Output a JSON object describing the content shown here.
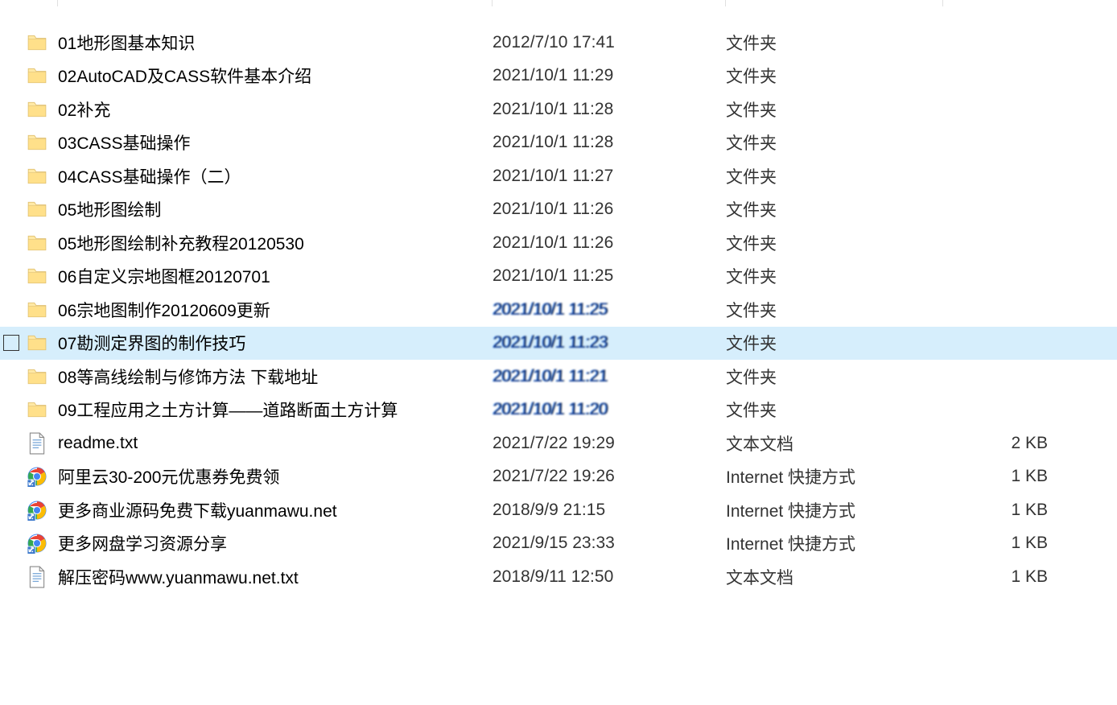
{
  "files": [
    {
      "icon": "folder",
      "name": "01地形图基本知识",
      "date": "2012/7/10 17:41",
      "type": "文件夹",
      "size": ""
    },
    {
      "icon": "folder",
      "name": "02AutoCAD及CASS软件基本介绍",
      "date": "2021/10/1 11:29",
      "type": "文件夹",
      "size": ""
    },
    {
      "icon": "folder",
      "name": "02补充",
      "date": "2021/10/1 11:28",
      "type": "文件夹",
      "size": ""
    },
    {
      "icon": "folder",
      "name": "03CASS基础操作",
      "date": "2021/10/1 11:28",
      "type": "文件夹",
      "size": ""
    },
    {
      "icon": "folder",
      "name": "04CASS基础操作（二）",
      "date": "2021/10/1 11:27",
      "type": "文件夹",
      "size": ""
    },
    {
      "icon": "folder",
      "name": "05地形图绘制",
      "date": "2021/10/1 11:26",
      "type": "文件夹",
      "size": ""
    },
    {
      "icon": "folder",
      "name": "05地形图绘制补充教程20120530",
      "date": "2021/10/1 11:26",
      "type": "文件夹",
      "size": ""
    },
    {
      "icon": "folder",
      "name": "06自定义宗地图框20120701",
      "date": "2021/10/1 11:25",
      "type": "文件夹",
      "size": ""
    },
    {
      "icon": "folder",
      "name": "06宗地图制作20120609更新",
      "date": "2021/10/1 11:25",
      "type": "文件夹",
      "size": "",
      "distorted": true
    },
    {
      "icon": "folder",
      "name": "07勘测定界图的制作技巧",
      "date": "2021/10/1 11:23",
      "type": "文件夹",
      "size": "",
      "hover": true,
      "distorted": true
    },
    {
      "icon": "folder",
      "name": "08等高线绘制与修饰方法 下载地址",
      "date": "2021/10/1 11:21",
      "type": "文件夹",
      "size": "",
      "distorted": true
    },
    {
      "icon": "folder",
      "name": "09工程应用之土方计算——道路断面土方计算",
      "date": "2021/10/1 11:20",
      "type": "文件夹",
      "size": "",
      "distorted": true
    },
    {
      "icon": "txt",
      "name": "readme.txt",
      "date": "2021/7/22 19:29",
      "type": "文本文档",
      "size": "2 KB"
    },
    {
      "icon": "url",
      "name": "阿里云30-200元优惠券免费领",
      "date": "2021/7/22 19:26",
      "type": "Internet 快捷方式",
      "size": "1 KB"
    },
    {
      "icon": "url",
      "name": "更多商业源码免费下载yuanmawu.net",
      "date": "2018/9/9 21:15",
      "type": "Internet 快捷方式",
      "size": "1 KB"
    },
    {
      "icon": "url",
      "name": "更多网盘学习资源分享",
      "date": "2021/9/15 23:33",
      "type": "Internet 快捷方式",
      "size": "1 KB"
    },
    {
      "icon": "txt",
      "name": "解压密码www.yuanmawu.net.txt",
      "date": "2018/9/11 12:50",
      "type": "文本文档",
      "size": "1 KB"
    }
  ]
}
